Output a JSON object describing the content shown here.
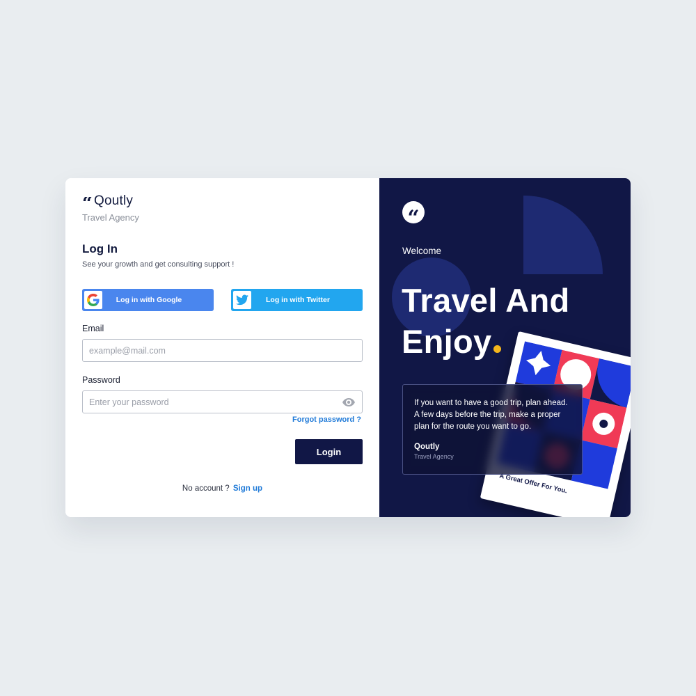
{
  "brand": {
    "mark": "“",
    "name": "Qoutly",
    "subtitle": "Travel Agency"
  },
  "login": {
    "title": "Log In",
    "subtitle": "See your growth and get consulting support !",
    "google_label": "Log in with Google",
    "twitter_label": "Log in with Twitter",
    "email_label": "Email",
    "email_placeholder": "example@mail.com",
    "password_label": "Password",
    "password_placeholder": "Enter your password",
    "forgot_label": "Forgot password ?",
    "login_label": "Login",
    "no_account_text": "No account ?",
    "signup_label": "Sign up"
  },
  "hero": {
    "quote_mark": "“",
    "welcome": "Welcome",
    "headline_line1": "Travel And",
    "headline_line2": "Enjoy",
    "postcard_caption": "A Great Offer For You.",
    "testimonial_text": "If you want to have a good trip, plan ahead. A few days before the trip, make a proper plan for the route you want to go.",
    "testimonial_author": "Qoutly",
    "testimonial_role": "Travel Agency"
  },
  "colors": {
    "navy": "#111746",
    "accent_blue": "#1f7ad8",
    "google_blue": "#4a86ee",
    "twitter_blue": "#22a6ef",
    "accent_yellow": "#f4b61c",
    "background": "#e9edf0"
  },
  "icons": [
    "google-icon",
    "twitter-icon",
    "eye-icon",
    "quote-icon"
  ]
}
